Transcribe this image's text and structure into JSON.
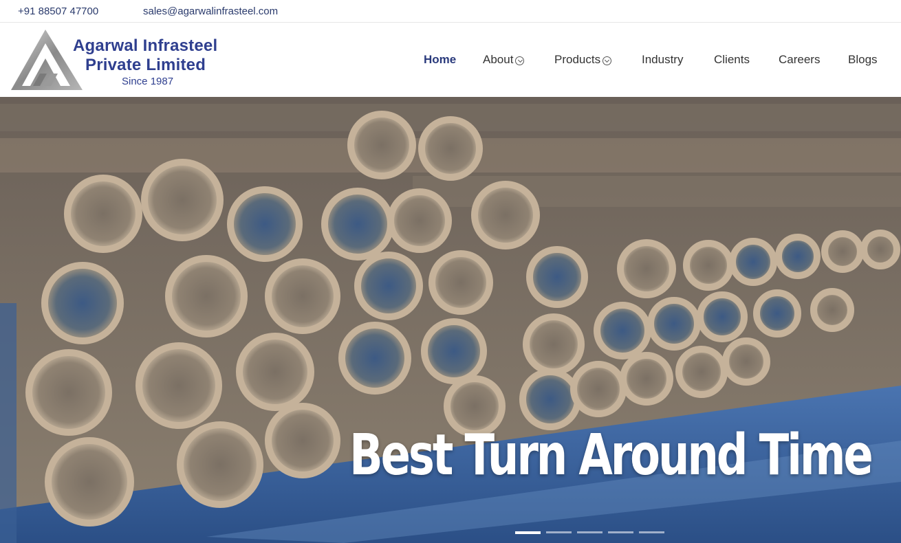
{
  "topbar": {
    "phone": "+91 88507 47700",
    "email": "sales@agarwalinfrasteel.com"
  },
  "logo": {
    "line1": "Agarwal Infrasteel",
    "line2": "Private Limited",
    "tagline": "Since 1987"
  },
  "nav": {
    "items": [
      {
        "label": "Home",
        "active": true
      },
      {
        "label": "About",
        "dropdown": true
      },
      {
        "label": "Products",
        "dropdown": true
      },
      {
        "label": "Industry"
      },
      {
        "label": "Clients"
      },
      {
        "label": "Careers"
      },
      {
        "label": "Blogs"
      }
    ]
  },
  "hero": {
    "title": "Best Turn Around Time",
    "slides_count": 5,
    "active_slide": 1
  },
  "colors": {
    "brand": "#2f3f8f",
    "nav_active": "#2a3a7c"
  }
}
